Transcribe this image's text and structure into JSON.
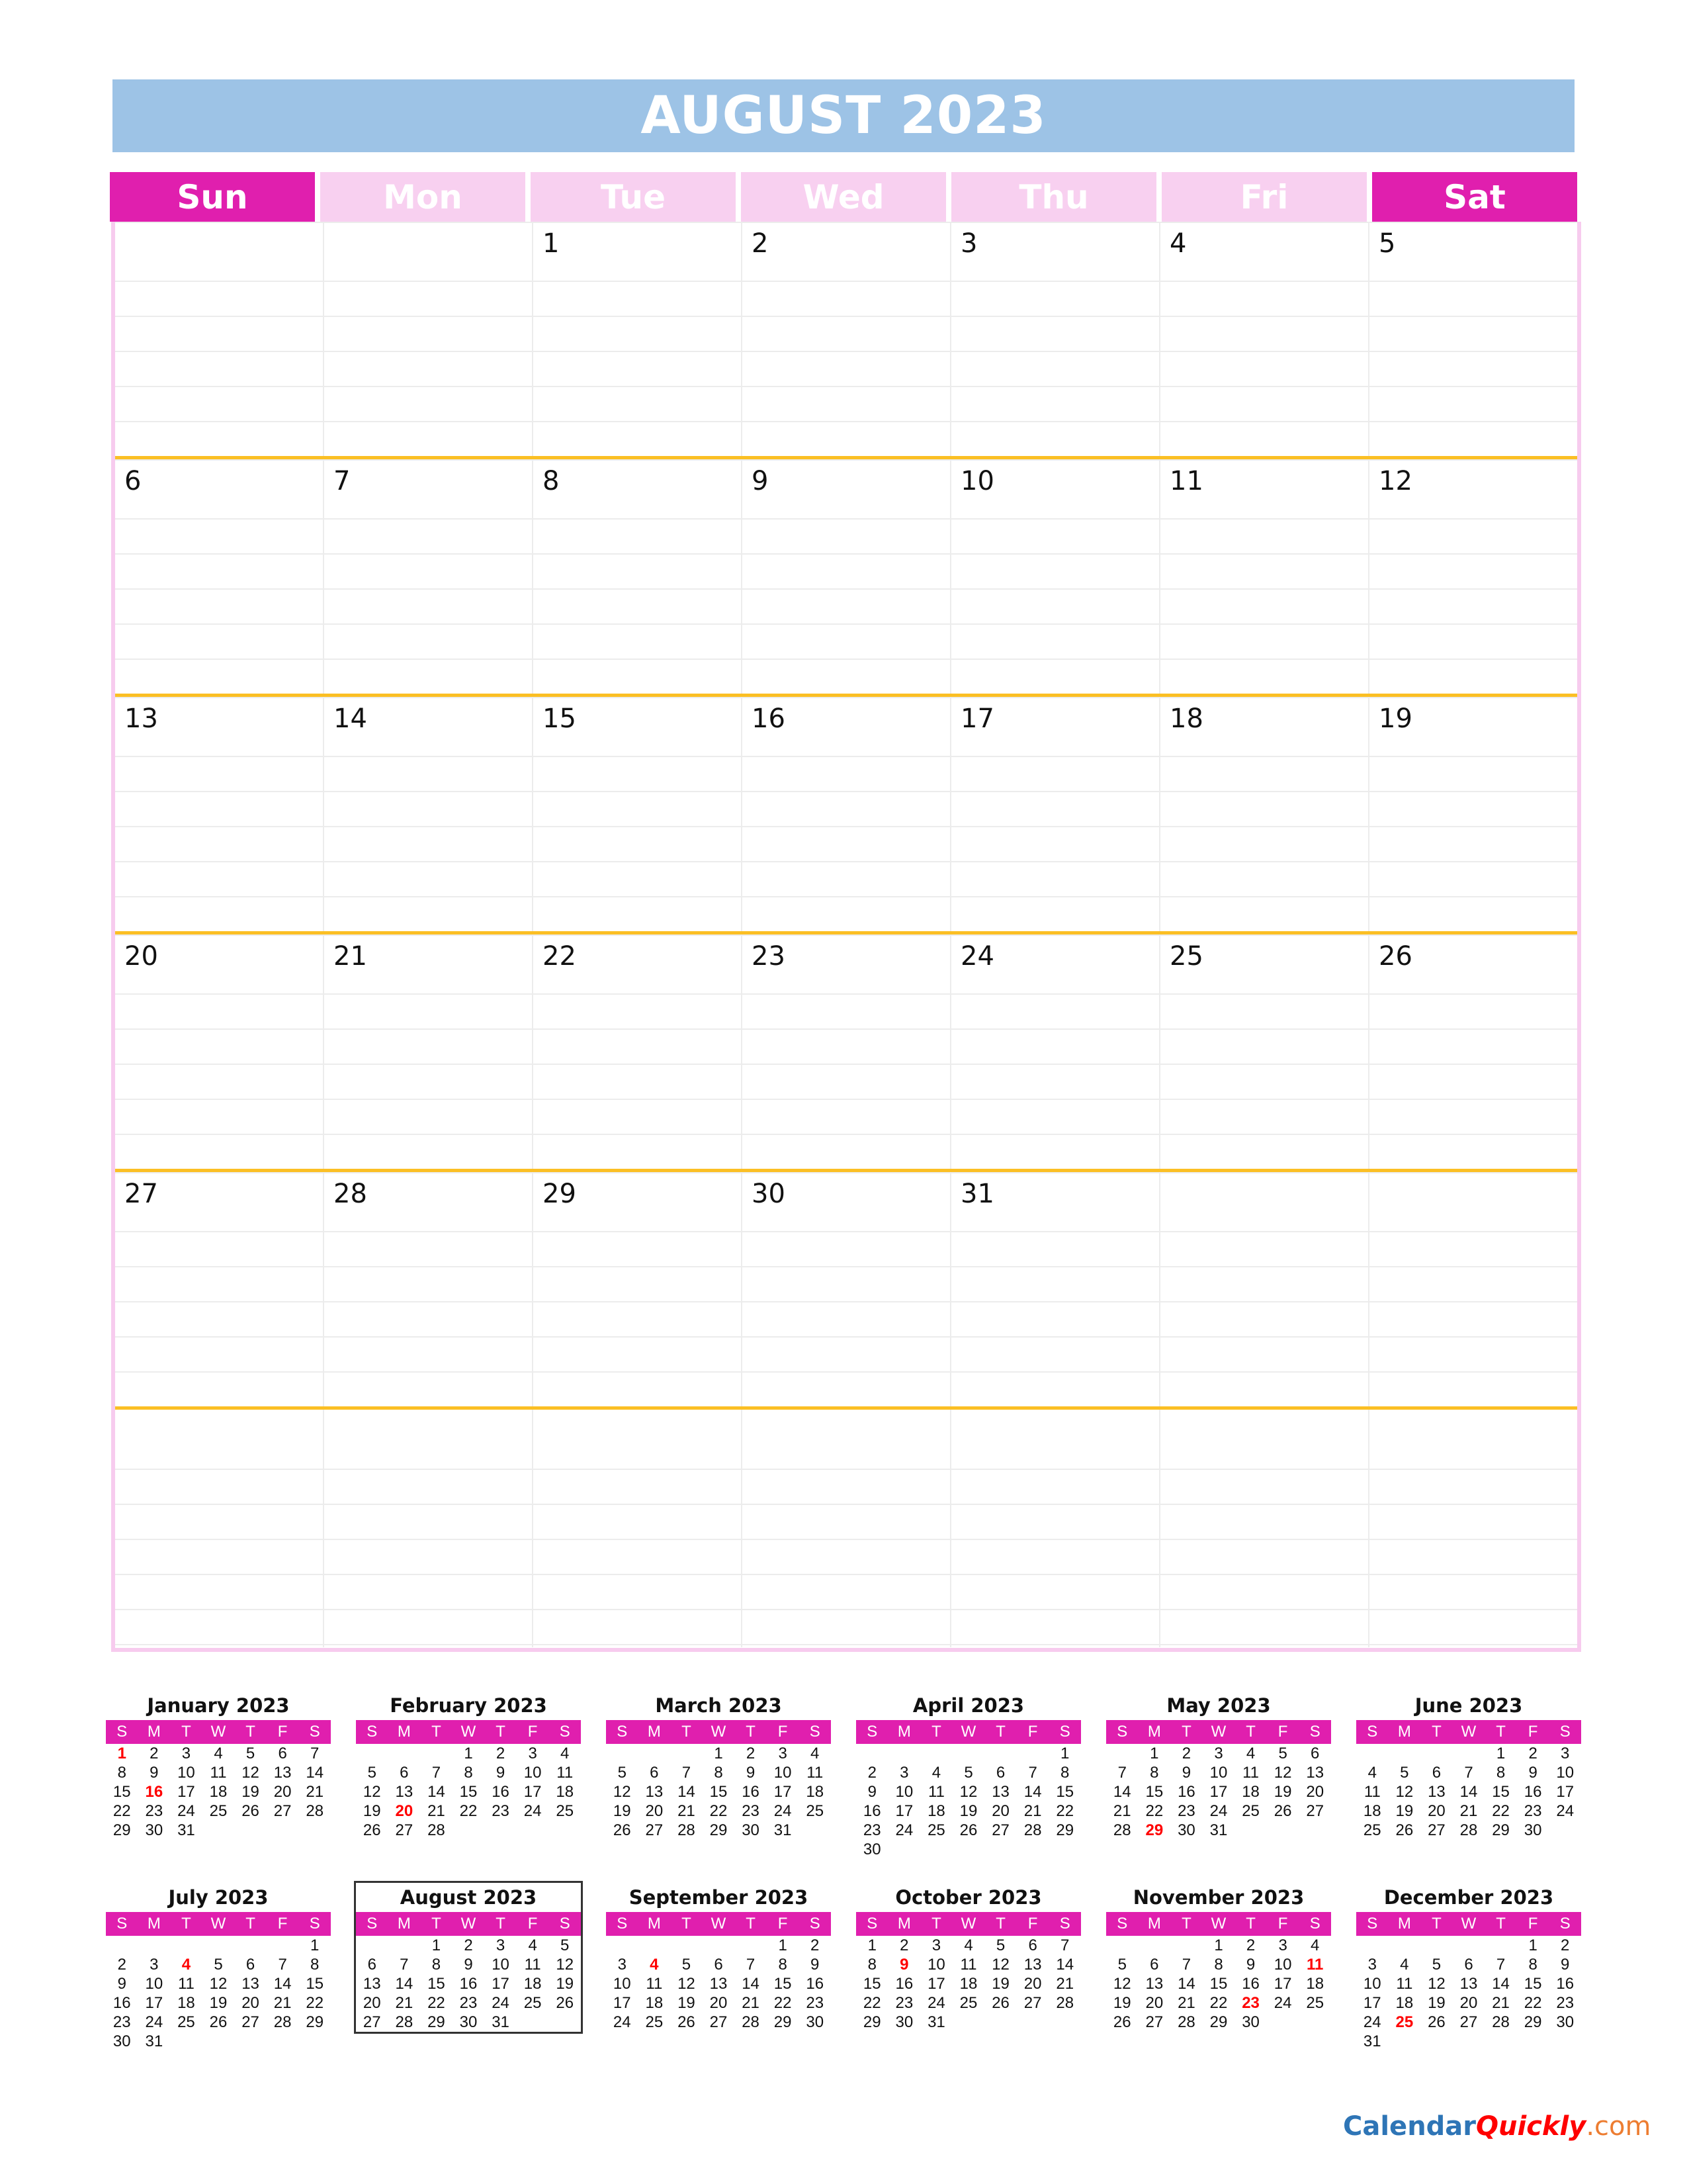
{
  "title": "AUGUST 2023",
  "weekdays": [
    "Sun",
    "Mon",
    "Tue",
    "Wed",
    "Thu",
    "Fri",
    "Sat"
  ],
  "weekend_color": "#e01fae",
  "weekday_color": "#f8d0f0",
  "title_color": "#9dc3e6",
  "week_separator_color": "#fbbf24",
  "weeks": [
    [
      "",
      "",
      "1",
      "2",
      "3",
      "4",
      "5"
    ],
    [
      "6",
      "7",
      "8",
      "9",
      "10",
      "11",
      "12"
    ],
    [
      "13",
      "14",
      "15",
      "16",
      "17",
      "18",
      "19"
    ],
    [
      "20",
      "21",
      "22",
      "23",
      "24",
      "25",
      "26"
    ],
    [
      "27",
      "28",
      "29",
      "30",
      "31",
      "",
      ""
    ],
    [
      "",
      "",
      "",
      "",
      "",
      "",
      ""
    ]
  ],
  "mini_header": [
    "S",
    "M",
    "T",
    "W",
    "T",
    "F",
    "S"
  ],
  "mini_calendars": [
    {
      "title": "January 2023",
      "offset": 0,
      "days": 31,
      "holidays": [
        1,
        16
      ]
    },
    {
      "title": "February 2023",
      "offset": 3,
      "days": 28,
      "holidays": [
        20
      ]
    },
    {
      "title": "March 2023",
      "offset": 3,
      "days": 31,
      "holidays": []
    },
    {
      "title": "April 2023",
      "offset": 6,
      "days": 30,
      "holidays": []
    },
    {
      "title": "May 2023",
      "offset": 1,
      "days": 31,
      "holidays": [
        29
      ]
    },
    {
      "title": "June 2023",
      "offset": 4,
      "days": 30,
      "holidays": []
    },
    {
      "title": "July 2023",
      "offset": 6,
      "days": 31,
      "holidays": [
        4
      ]
    },
    {
      "title": "August 2023",
      "offset": 2,
      "days": 31,
      "holidays": [],
      "current": true
    },
    {
      "title": "September 2023",
      "offset": 5,
      "days": 30,
      "holidays": [
        4
      ]
    },
    {
      "title": "October 2023",
      "offset": 0,
      "days": 31,
      "holidays": [
        9
      ]
    },
    {
      "title": "November 2023",
      "offset": 3,
      "days": 30,
      "holidays": [
        11,
        23
      ]
    },
    {
      "title": "December 2023",
      "offset": 5,
      "days": 31,
      "holidays": [
        25
      ]
    }
  ],
  "logo": {
    "part1": "Calendar",
    "part2": "Quickly",
    "part3": ".com"
  }
}
